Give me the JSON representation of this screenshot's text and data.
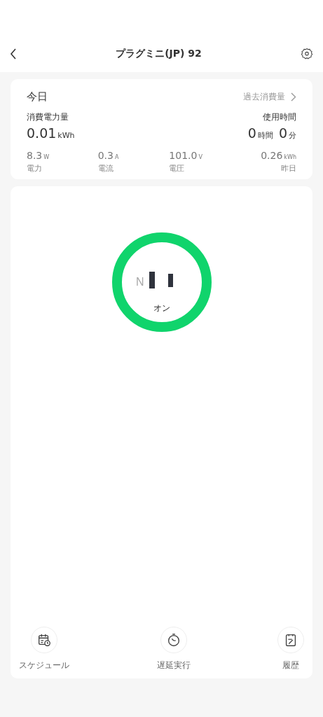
{
  "header": {
    "title": "プラグミニ(JP) 92"
  },
  "today": {
    "title": "今日",
    "history_link": "過去消費量",
    "energy_label": "消費電力量",
    "energy_value": "0.01",
    "energy_unit": "kWh",
    "time_label": "使用時間",
    "hours_value": "0",
    "hours_unit": "時間",
    "minutes_value": "0",
    "minutes_unit": "分",
    "metrics": [
      {
        "value": "8.3",
        "unit": "W",
        "label": "電力"
      },
      {
        "value": "0.3",
        "unit": "A",
        "label": "電流"
      },
      {
        "value": "101.0",
        "unit": "V",
        "label": "電圧"
      },
      {
        "value": "0.26",
        "unit": "kWh",
        "label": "昨日"
      }
    ]
  },
  "power": {
    "on": true,
    "label": "オン",
    "socket_mark": "N"
  },
  "actions": [
    {
      "kind": "schedule",
      "label": "スケジュール"
    },
    {
      "kind": "timer",
      "label": "遅延実行"
    },
    {
      "kind": "history",
      "label": "履歴"
    }
  ]
}
